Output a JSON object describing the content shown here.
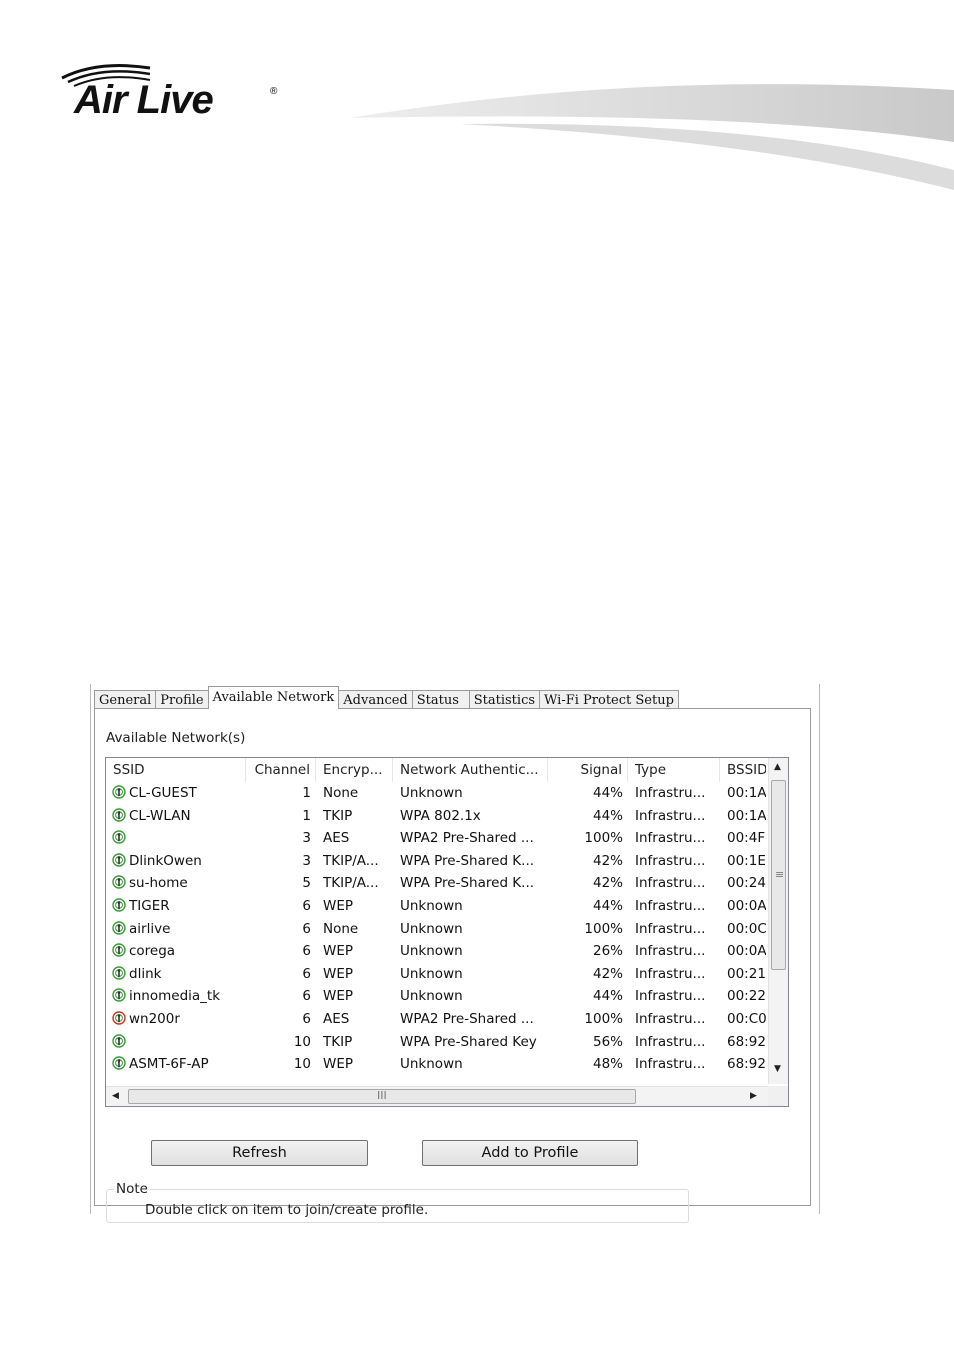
{
  "brand": {
    "logo_text": "Air Live",
    "registered": "®"
  },
  "tabs": [
    {
      "label": "General",
      "active": false
    },
    {
      "label": "Profile",
      "active": false
    },
    {
      "label": "Available Network",
      "active": true
    },
    {
      "label": "Advanced",
      "active": false
    },
    {
      "label": "Status",
      "active": false
    },
    {
      "label": "Statistics",
      "active": false
    },
    {
      "label": "Wi-Fi Protect Setup",
      "active": false
    }
  ],
  "group_title": "Available Network(s)",
  "columns": [
    {
      "key": "ssid",
      "label": "SSID"
    },
    {
      "key": "channel",
      "label": "Channel"
    },
    {
      "key": "encryption",
      "label": "Encryp..."
    },
    {
      "key": "auth",
      "label": "Network Authentic..."
    },
    {
      "key": "signal",
      "label": "Signal"
    },
    {
      "key": "type",
      "label": "Type"
    },
    {
      "key": "bssid",
      "label": "BSSID"
    }
  ],
  "networks": [
    {
      "ssid": "CL-GUEST",
      "channel": "1",
      "encryption": "None",
      "auth": "Unknown",
      "signal": "44%",
      "type": "Infrastru...",
      "bssid": "00:1A",
      "icon": "wifi-ap-icon"
    },
    {
      "ssid": "CL-WLAN",
      "channel": "1",
      "encryption": "TKIP",
      "auth": "WPA 802.1x",
      "signal": "44%",
      "type": "Infrastru...",
      "bssid": "00:1A",
      "icon": "wifi-ap-icon"
    },
    {
      "ssid": "",
      "channel": "3",
      "encryption": "AES",
      "auth": "WPA2 Pre-Shared ...",
      "signal": "100%",
      "type": "Infrastru...",
      "bssid": "00:4F",
      "icon": "wifi-ap-icon"
    },
    {
      "ssid": "DlinkOwen",
      "channel": "3",
      "encryption": "TKIP/A...",
      "auth": "WPA Pre-Shared K...",
      "signal": "42%",
      "type": "Infrastru...",
      "bssid": "00:1E",
      "icon": "wifi-ap-icon"
    },
    {
      "ssid": "su-home",
      "channel": "5",
      "encryption": "TKIP/A...",
      "auth": "WPA Pre-Shared K...",
      "signal": "42%",
      "type": "Infrastru...",
      "bssid": "00:24",
      "icon": "wifi-ap-icon"
    },
    {
      "ssid": "TIGER",
      "channel": "6",
      "encryption": "WEP",
      "auth": "Unknown",
      "signal": "44%",
      "type": "Infrastru...",
      "bssid": "00:0A",
      "icon": "wifi-ap-icon"
    },
    {
      "ssid": "airlive",
      "channel": "6",
      "encryption": "None",
      "auth": "Unknown",
      "signal": "100%",
      "type": "Infrastru...",
      "bssid": "00:0C",
      "icon": "wifi-ap-icon"
    },
    {
      "ssid": "corega",
      "channel": "6",
      "encryption": "WEP",
      "auth": "Unknown",
      "signal": "26%",
      "type": "Infrastru...",
      "bssid": "00:0A",
      "icon": "wifi-ap-icon"
    },
    {
      "ssid": "dlink",
      "channel": "6",
      "encryption": "WEP",
      "auth": "Unknown",
      "signal": "42%",
      "type": "Infrastru...",
      "bssid": "00:21",
      "icon": "wifi-ap-icon"
    },
    {
      "ssid": "innomedia_tk",
      "channel": "6",
      "encryption": "WEP",
      "auth": "Unknown",
      "signal": "44%",
      "type": "Infrastru...",
      "bssid": "00:22",
      "icon": "wifi-ap-icon"
    },
    {
      "ssid": "wn200r",
      "channel": "6",
      "encryption": "AES",
      "auth": "WPA2 Pre-Shared ...",
      "signal": "100%",
      "type": "Infrastru...",
      "bssid": "00:C0",
      "icon": "wifi-ap-connected-icon"
    },
    {
      "ssid": "",
      "channel": "10",
      "encryption": "TKIP",
      "auth": "WPA Pre-Shared Key",
      "signal": "56%",
      "type": "Infrastru...",
      "bssid": "68:92",
      "icon": "wifi-ap-icon"
    },
    {
      "ssid": "ASMT-6F-AP",
      "channel": "10",
      "encryption": "WEP",
      "auth": "Unknown",
      "signal": "48%",
      "type": "Infrastru...",
      "bssid": "68:92",
      "icon": "wifi-ap-icon"
    }
  ],
  "scrollbar": {
    "up": "▲",
    "down": "▼",
    "left": "◀",
    "right": "▶",
    "vgrip": "≡",
    "hgrip": "III"
  },
  "buttons": {
    "refresh": "Refresh",
    "add_to_profile": "Add to Profile"
  },
  "note": {
    "title": "Note",
    "text": "Double click on item to join/create profile."
  },
  "colors": {
    "icon_green": "#3a9a3a",
    "icon_red": "#d03020",
    "border": "#9a9a9a"
  }
}
